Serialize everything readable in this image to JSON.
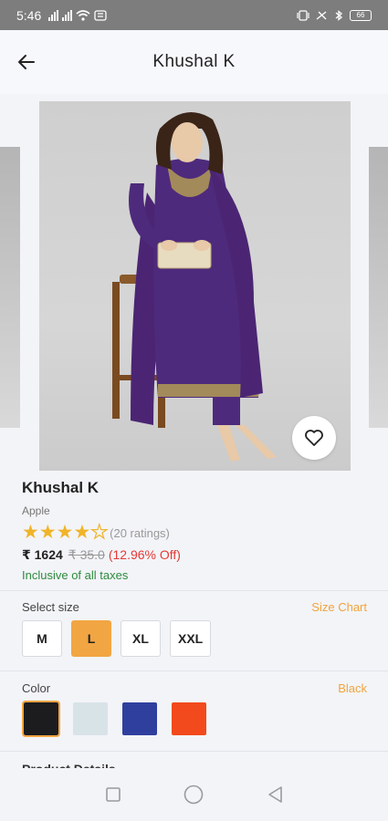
{
  "status_bar": {
    "time": "5:46",
    "battery": "66"
  },
  "header": {
    "title": "Khushal K"
  },
  "product": {
    "name": "Khushal K",
    "brand": "Apple",
    "rating_stars": 4,
    "rating_max": 5,
    "rating_count": "(20 ratings)",
    "price": "₹ 1624",
    "mrp": "₹ 35.0",
    "discount": "(12.96% Off)",
    "tax_note": "Inclusive of all taxes"
  },
  "size_section": {
    "label": "Select size",
    "chart_link": "Size Chart",
    "options": [
      "M",
      "L",
      "XL",
      "XXL"
    ],
    "selected": "L"
  },
  "color_section": {
    "label": "Color",
    "selected_name": "Black",
    "swatches": [
      "#1c1c1f",
      "#d8e3e8",
      "#2f3f9e",
      "#f24a1c"
    ],
    "selected_index": 0
  },
  "details_section": {
    "label": "Product Details"
  },
  "colors": {
    "accent": "#f2a543",
    "discount": "#e53935",
    "tax": "#2e8b3e",
    "star": "#f0b429"
  },
  "icons": {
    "back": "arrow-left-icon",
    "favorite": "heart-outline-icon"
  }
}
